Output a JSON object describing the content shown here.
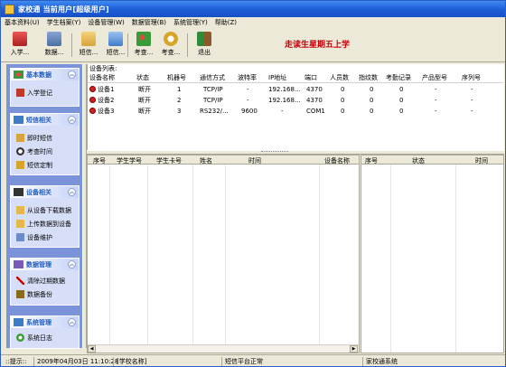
{
  "window": {
    "title": "家校通  当前用户[超级用户]"
  },
  "menu": [
    "基本资料(U)",
    "学生档案(Y)",
    "设备管理(W)",
    "数据管理(B)",
    "系统管理(Y)",
    "帮助(Z)"
  ],
  "toolbar": {
    "buttons": [
      {
        "label": "入学...",
        "icon": "enroll-icon",
        "color": "#c0392b"
      },
      {
        "label": "数据...",
        "icon": "database-icon",
        "color": "#4a6fa5"
      },
      {
        "label": "短信...",
        "icon": "sms-icon",
        "color": "#d9a43c"
      },
      {
        "label": "短信...",
        "icon": "sms-custom-icon",
        "color": "#3d7dc8"
      },
      {
        "label": "考查...",
        "icon": "check-icon",
        "color": "#3a9a3a"
      },
      {
        "label": "考查...",
        "icon": "time-icon",
        "color": "#d6a52a"
      },
      {
        "label": "退出",
        "icon": "exit-icon",
        "color": "#2e8b3a"
      }
    ],
    "greeting": "走读生星期五上学"
  },
  "sidebar": {
    "sections": [
      {
        "title": "基本数据",
        "items": [
          {
            "label": "入学登记",
            "icon": "enroll-icon"
          }
        ]
      },
      {
        "title": "短信相关",
        "items": [
          {
            "label": "即时短信",
            "icon": "sms-icon"
          },
          {
            "label": "考查时间",
            "icon": "clock-icon"
          },
          {
            "label": "短信定制",
            "icon": "edit-icon"
          }
        ]
      },
      {
        "title": "设备相关",
        "items": [
          {
            "label": "从设备下载数据",
            "icon": "download-icon"
          },
          {
            "label": "上传数据到设备",
            "icon": "upload-icon"
          },
          {
            "label": "设备维护",
            "icon": "device-icon"
          }
        ]
      },
      {
        "title": "数据管理",
        "items": [
          {
            "label": "清除过期数据",
            "icon": "delete-icon"
          },
          {
            "label": "数据备份",
            "icon": "backup-icon"
          }
        ]
      },
      {
        "title": "系统管理",
        "items": [
          {
            "label": "系统日志",
            "icon": "log-icon"
          }
        ]
      }
    ]
  },
  "devices": {
    "label": "设备列表:",
    "columns": [
      "设备名称",
      "状态",
      "机器号",
      "通信方式",
      "波特率",
      "IP地址",
      "端口",
      "人员数",
      "指纹数",
      "考勤记录",
      "产品型号",
      "序列号"
    ],
    "rows": [
      [
        "设备1",
        "断开",
        "1",
        "TCP/IP",
        "-",
        "192.168...",
        "4370",
        "0",
        "0",
        "0",
        "-",
        "-"
      ],
      [
        "设备2",
        "断开",
        "2",
        "TCP/IP",
        "-",
        "192.168...",
        "4370",
        "0",
        "0",
        "0",
        "-",
        "-"
      ],
      [
        "设备3",
        "断开",
        "3",
        "RS232/...",
        "9600",
        "-",
        "COM1",
        "0",
        "0",
        "0",
        "-",
        "-"
      ]
    ],
    "status_color": "#d41e1e"
  },
  "records": {
    "columns": [
      "序号",
      "学生学号",
      "学生卡号",
      "姓名",
      "时间",
      "设备名称"
    ]
  },
  "log": {
    "columns": [
      "序号",
      "状态",
      "时间"
    ]
  },
  "status": {
    "hint": "::提示::",
    "datetime": "2009年04月03日 11:10:28",
    "school": "[学校名称]",
    "sms": "短信平台正常",
    "app": "家校通系统"
  }
}
